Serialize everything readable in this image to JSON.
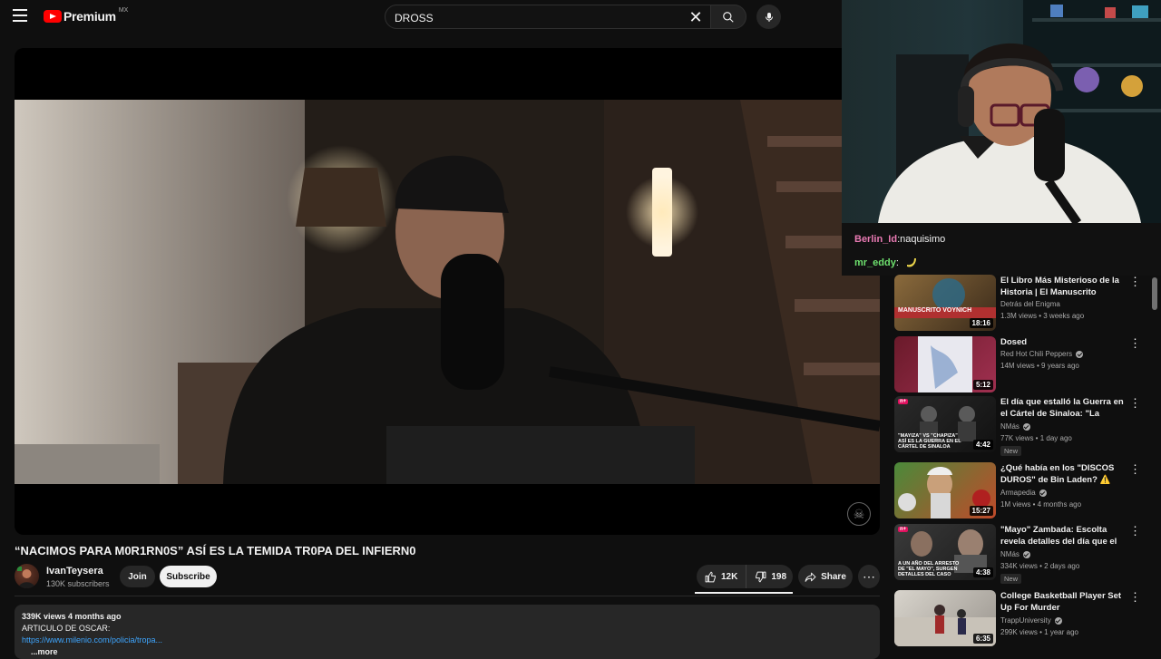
{
  "header": {
    "brand": "Premium",
    "country": "MX",
    "search_value": "DROSS"
  },
  "video": {
    "title": "“NACIMOS PARA M0R1RN0S” ASÍ ES LA TEMIDA TR0PA DEL INFIERN0",
    "channel": "IvanTeysera",
    "subscribers": "130K subscribers",
    "join_label": "Join",
    "subscribe_label": "Subscribe",
    "likes": "12K",
    "dislikes": "198",
    "share_label": "Share",
    "description": {
      "meta": "339K views  4 months ago",
      "line1": "ARTICULO DE OSCAR:",
      "link": "https://www.milenio.com/policia/tropa...",
      "more": "...more"
    }
  },
  "chat": [
    {
      "user": "Berlin_Id",
      "message": " naquisimo"
    },
    {
      "user": "mr_eddy",
      "message": ""
    }
  ],
  "recommendations": [
    {
      "title": "El Libro Más Misterioso de la Historia | El Manuscrito Voynich",
      "channel": "Detrás del Enigma",
      "stats": "1.3M views • 3 weeks ago",
      "duration": "18:16",
      "thumb_text": "MANUSCRITO VOYNICH"
    },
    {
      "title": "Dosed",
      "channel": "Red Hot Chili Peppers",
      "stats": "14M views • 9 years ago",
      "duration": "5:12"
    },
    {
      "title": "El día que estalló la Guerra en el Cártel de Sinaloa: \"La Mayiza\" ...",
      "channel": "NMás",
      "stats": "77K views • 1 day ago",
      "duration": "4:42",
      "badge": "New",
      "thumb_text": "\"MAYIZA\" VS \"CHAPIZA\" ASÍ ES LA GUERRA EN EL CÁRTEL DE SINALOA",
      "tag": "n+"
    },
    {
      "title": "¿Qué había en los \"DISCOS DUROS\" de Bin Laden? ⚠️",
      "channel": "Armapedia",
      "stats": "1M views • 4 months ago",
      "duration": "15:27"
    },
    {
      "title": "\"Mayo\" Zambada: Escolta revela detalles del día que el capo fu...",
      "channel": "NMás",
      "stats": "334K views • 2 days ago",
      "duration": "4:38",
      "badge": "New",
      "thumb_text": "A UN AÑO DEL ARRESTO DE \"EL MAYO\", SURGEN DETALLES DEL CASO",
      "tag": "n+"
    },
    {
      "title": "College Basketball Player Set Up For Murder",
      "channel": "TrappUniversity",
      "stats": "299K views • 1 year ago",
      "duration": "6:35"
    }
  ],
  "colors": {
    "accent_red": "#ff0000",
    "link_blue": "#3ea6ff",
    "chat_user1": "#e97ab3",
    "chat_user2": "#6ee16e"
  }
}
